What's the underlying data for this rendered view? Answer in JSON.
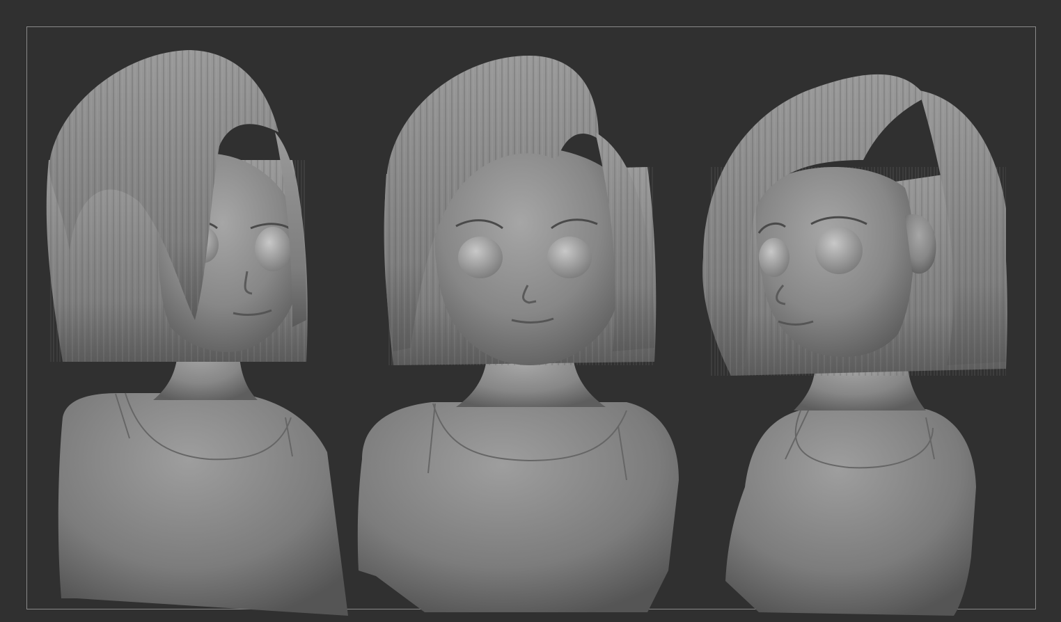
{
  "viewport": {
    "background_color": "#303030",
    "frame_color": "#8a8a8a",
    "clay_color": "#8c8c8c"
  },
  "views": [
    {
      "name": "three-quarter-left-view"
    },
    {
      "name": "front-view"
    },
    {
      "name": "three-quarter-right-view"
    }
  ]
}
